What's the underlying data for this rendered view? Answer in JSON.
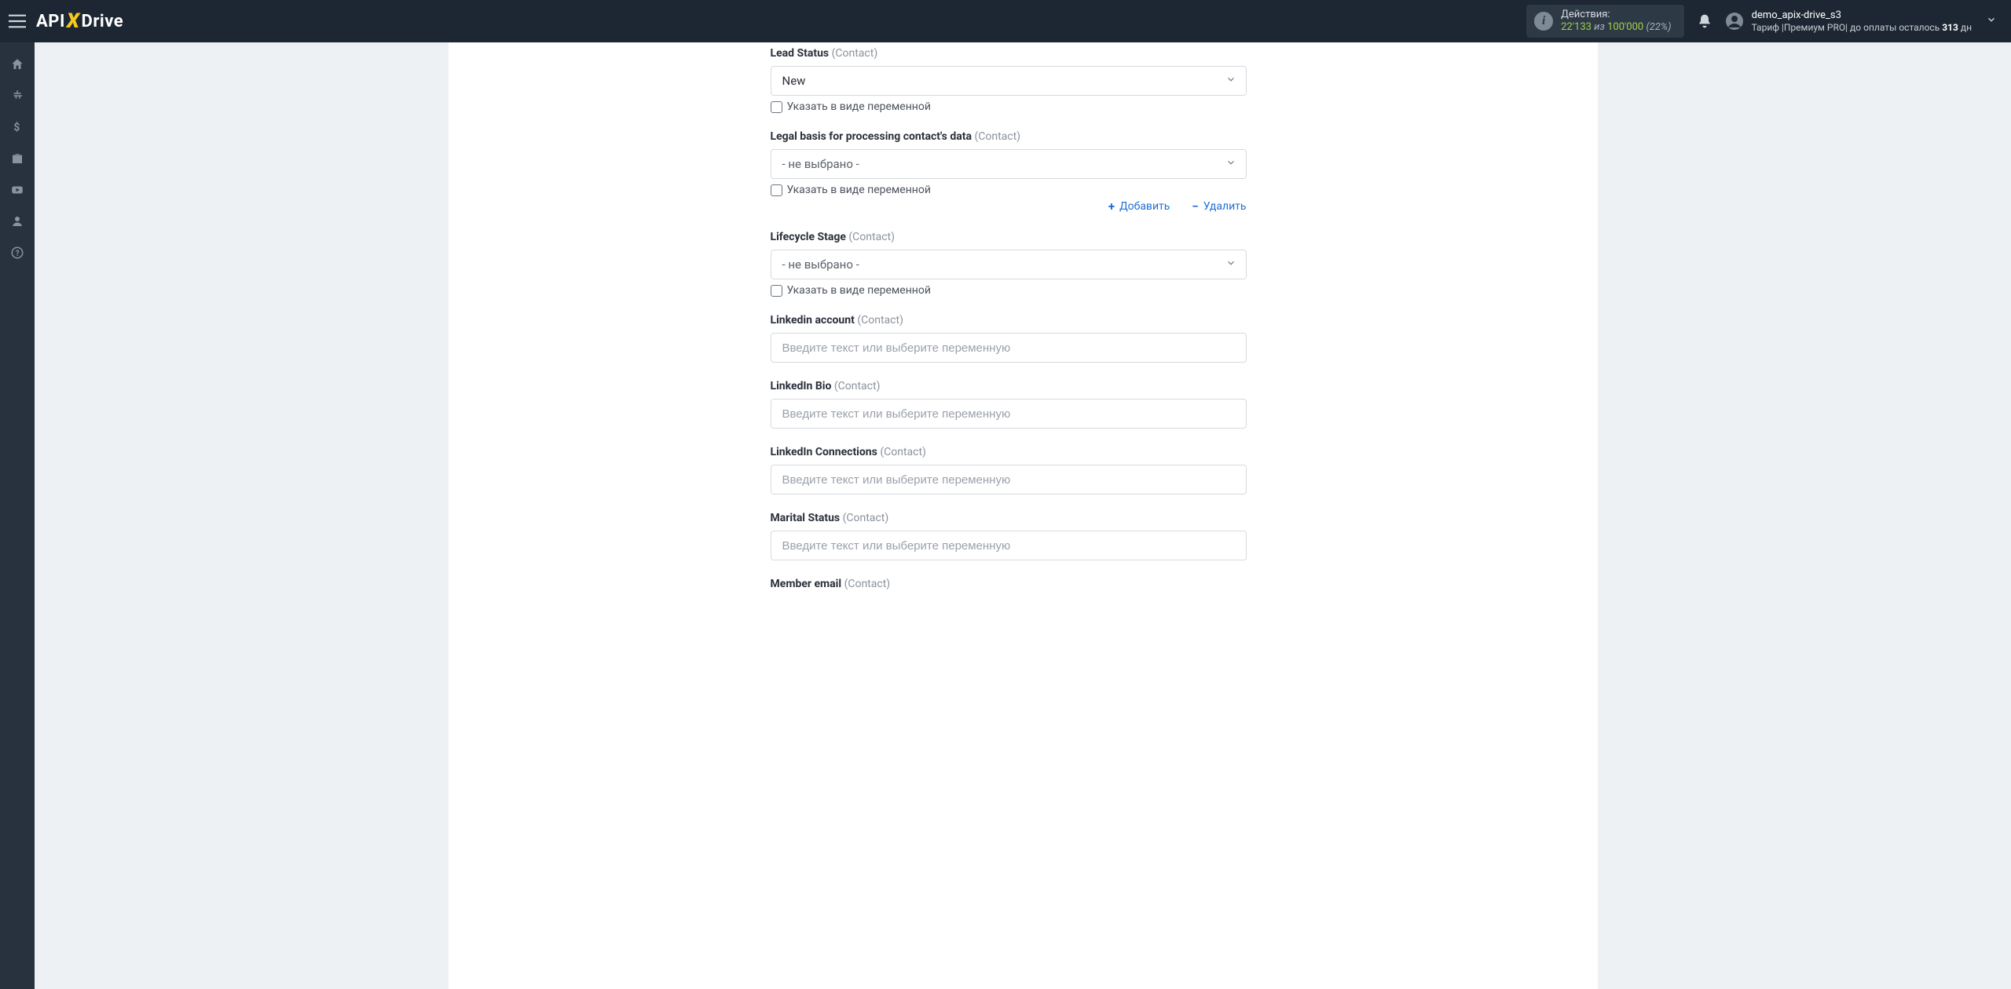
{
  "header": {
    "actions": {
      "label": "Действия:",
      "current": "22'133",
      "of": "из",
      "total": "100'000",
      "percent": "(22%)"
    },
    "user": {
      "name": "demo_apix-drive_s3",
      "tariff_prefix": "Тариф |",
      "tariff_name": "Премиум PRO",
      "tariff_mid": "| до оплаты осталось ",
      "days": "313",
      "days_suffix": " дн"
    }
  },
  "form": {
    "placeholder_text": "Введите текст или выберите переменную",
    "var_checkbox": "Указать в виде переменной",
    "not_selected": "- не выбрано -",
    "add_label": "Добавить",
    "delete_label": "Удалить",
    "fields": {
      "lead_status": {
        "label": "Lead Status",
        "sub": "(Contact)",
        "value": "New"
      },
      "legal_basis": {
        "label": "Legal basis for processing contact's data",
        "sub": "(Contact)"
      },
      "lifecycle": {
        "label": "Lifecycle Stage",
        "sub": "(Contact)"
      },
      "linkedin_account": {
        "label": "Linkedin account",
        "sub": "(Contact)"
      },
      "linkedin_bio": {
        "label": "LinkedIn Bio",
        "sub": "(Contact)"
      },
      "linkedin_conn": {
        "label": "LinkedIn Connections",
        "sub": "(Contact)"
      },
      "marital": {
        "label": "Marital Status",
        "sub": "(Contact)"
      },
      "member_email": {
        "label": "Member email",
        "sub": "(Contact)"
      }
    }
  }
}
